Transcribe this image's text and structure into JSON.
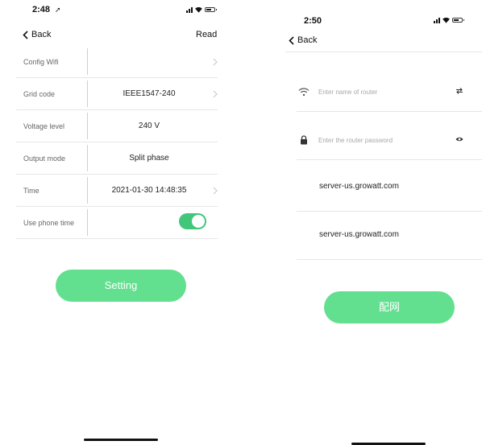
{
  "left": {
    "status_time": "2:48",
    "back_label": "Back",
    "read_label": "Read",
    "rows": [
      {
        "label": "Config Wifi",
        "value": ""
      },
      {
        "label": "Grid code",
        "value": "IEEE1547-240"
      },
      {
        "label": "Voltage level",
        "value": "240 V"
      },
      {
        "label": "Output mode",
        "value": "Split phase"
      },
      {
        "label": "Time",
        "value": "2021-01-30 14:48:35"
      },
      {
        "label": "Use phone time",
        "value": "",
        "toggle_on": true
      }
    ],
    "setting_button": "Setting"
  },
  "right": {
    "status_time": "2:50",
    "back_label": "Back",
    "router_name_placeholder": "Enter name of router",
    "router_password_placeholder": "Enter the router password",
    "servers": [
      "server-us.growatt.com",
      "server-us.growatt.com"
    ],
    "config_button": "配网"
  },
  "colors": {
    "accent": "#63e08f",
    "toggle_on": "#42c77a",
    "divider": "#e6e6e6"
  },
  "icons": {
    "wifi": "wifi-icon",
    "lock": "lock-icon",
    "swap": "swap-icon",
    "eye": "eye-icon",
    "chevron": "chevron-right-icon",
    "back": "chevron-left-icon"
  }
}
